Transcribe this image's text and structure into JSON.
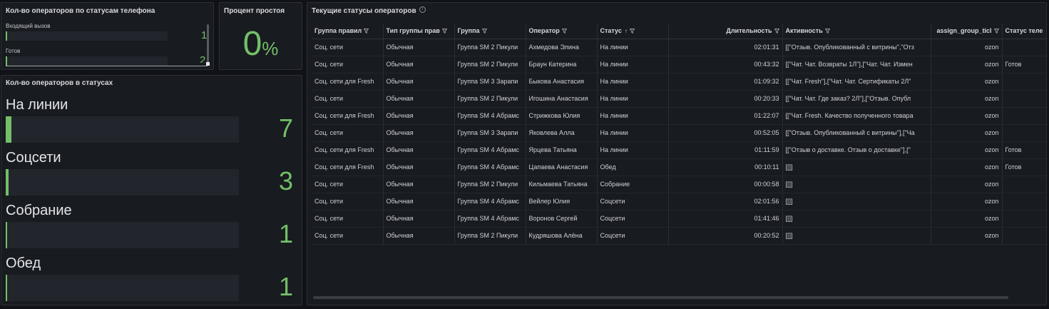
{
  "phone_panel": {
    "title": "Кол-во операторов по статусам телефона",
    "rows": [
      {
        "label": "Входящий вызов",
        "value": "1",
        "fill_fraction": 0.01
      },
      {
        "label": "Готов",
        "value": "2",
        "fill_fraction": 0.01
      }
    ]
  },
  "idle_panel": {
    "title": "Процент простоя",
    "value": "0",
    "unit": "%"
  },
  "status_panel": {
    "title": "Кол-во операторов в статусах",
    "rows": [
      {
        "label": "На линии",
        "value": "7",
        "fill_fraction": 0.025
      },
      {
        "label": "Соцсети",
        "value": "3",
        "fill_fraction": 0.012
      },
      {
        "label": "Собрание",
        "value": "1",
        "fill_fraction": 0.006
      },
      {
        "label": "Обед",
        "value": "1",
        "fill_fraction": 0.006
      }
    ]
  },
  "table_panel": {
    "title": "Текущие статусы операторов",
    "info_icon": "i",
    "sort_icon": "↑",
    "columns": [
      "Группа правил",
      "Тип группы прав",
      "Группа",
      "Оператор",
      "Статус",
      "Длительность",
      "Активность",
      "assign_group_ticl",
      "Статус теле"
    ],
    "rows": [
      [
        "Соц. сети",
        "Обычная",
        "Группа SM 2 Пикули",
        "Ахмедова Элина",
        "На линии",
        "02:01:31",
        "[[\"Отзыв. Опубликованный с витрины\",\"Отз",
        "ozon",
        ""
      ],
      [
        "Соц. сети",
        "Обычная",
        "Группа SM 2 Пикули",
        "Браун Катерина",
        "На линии",
        "00:43:32",
        "[[\"Чат. Чат. Возвраты 1Л\"],[\"Чат. Чат. Измен",
        "ozon",
        "Готов"
      ],
      [
        "Соц. сети для Fresh",
        "Обычная",
        "Группа SM 3 Зарапи",
        "Быкова Анастасия",
        "На линии",
        "01:09:32",
        "[[\"Чат. Fresh\"],[\"Чат. Чат. Сертификаты 2Л\"",
        "ozon",
        ""
      ],
      [
        "Соц. сети",
        "Обычная",
        "Группа SM 2 Пикули",
        "Игошина Анастасия",
        "На линии",
        "00:20:33",
        "[[\"Чат. Чат. Где заказ? 2Л\"],[\"Отзыв. Опубл",
        "ozon",
        ""
      ],
      [
        "Соц. сети для Fresh",
        "Обычная",
        "Группа SM 4 Абрамс",
        "Стрижкова Юлия",
        "На линии",
        "01:22:07",
        "[[\"Чат. Fresh. Качество полученного товара",
        "ozon",
        ""
      ],
      [
        "Соц. сети",
        "Обычная",
        "Группа SM 3 Зарапи",
        "Яковлева Алла",
        "На линии",
        "00:52:05",
        "[[\"Отзыв. Опубликованный с витрины\"],[\"Ча",
        "ozon",
        ""
      ],
      [
        "Соц. сети для Fresh",
        "Обычная",
        "Группа SM 4 Абрамс",
        "Ярцева Татьяна",
        "На линии",
        "01:11:59",
        "[[\"Отзыв о доставке. Отзыв о доставке\"],[\"",
        "ozon",
        "Готов"
      ],
      [
        "Соц. сети для Fresh",
        "Обычная",
        "Группа SM 4 Абрамс",
        "Цапаева Анастасия",
        "Обед",
        "00:10:11",
        "[[]]",
        "ozon",
        "Готов"
      ],
      [
        "Соц. сети",
        "Обычная",
        "Группа SM 2 Пикули",
        "Кильмаева Татьяна",
        "Собрание",
        "00:00:58",
        "[[]]",
        "ozon",
        ""
      ],
      [
        "Соц. сети",
        "Обычная",
        "Группа SM 4 Абрамс",
        "Вейлер Юлия",
        "Соцсети",
        "02:01:56",
        "[[]]",
        "ozon",
        ""
      ],
      [
        "Соц. сети",
        "Обычная",
        "Группа SM 4 Абрамс",
        "Воронов Сергей",
        "Соцсети",
        "01:41:46",
        "[[]]",
        "ozon",
        ""
      ],
      [
        "Соц. сети",
        "Обычная",
        "Группа SM 2 Пикули",
        "Кудряшова Алёна",
        "Соцсети",
        "00:20:52",
        "[[]]",
        "ozon",
        ""
      ]
    ]
  },
  "colors": {
    "accent_green": "#73bf69",
    "panel_bg": "#181b1f",
    "page_bg": "#111217"
  }
}
